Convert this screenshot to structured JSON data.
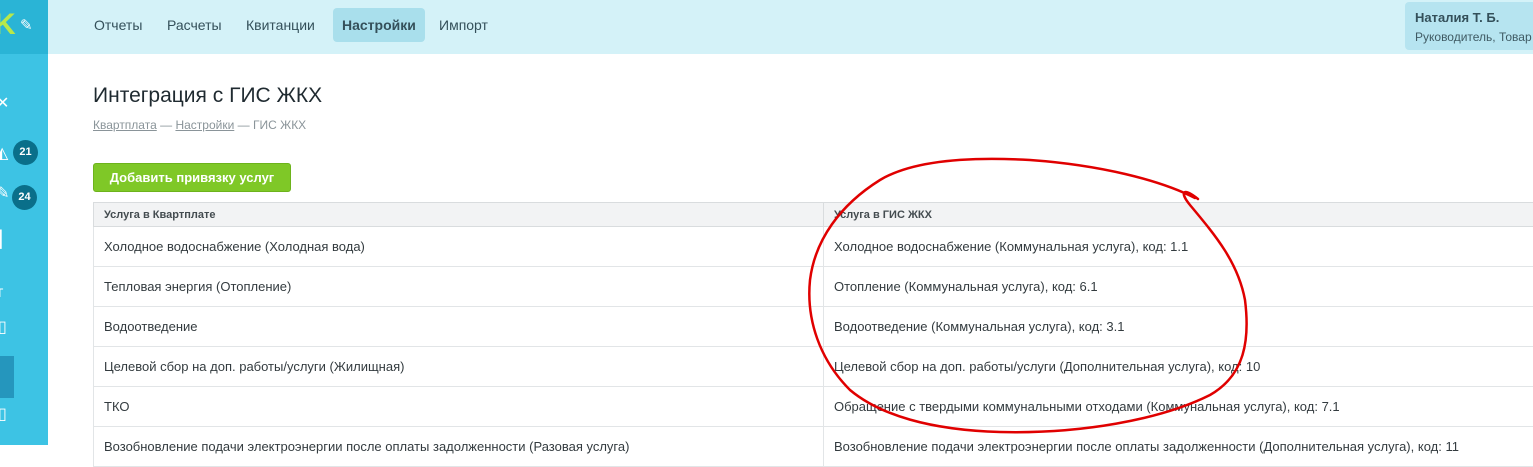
{
  "sidebar": {
    "badges": [
      "21",
      "24"
    ]
  },
  "nav": {
    "items": [
      {
        "label": "Отчеты"
      },
      {
        "label": "Расчеты"
      },
      {
        "label": "Квитанции"
      },
      {
        "label": "Настройки"
      },
      {
        "label": "Импорт"
      }
    ],
    "active": "Настройки"
  },
  "user": {
    "name": "Наталия Т. Б.",
    "role": "Руководитель, Товар"
  },
  "page": {
    "title": "Интеграция с ГИС ЖКХ",
    "breadcrumb": [
      "Квартплата",
      "Настройки",
      "ГИС ЖКХ"
    ],
    "separator": "—",
    "add_button": "Добавить привязку услуг"
  },
  "table": {
    "headers": [
      "Услуга в Квартплате",
      "Услуга в ГИС ЖКХ"
    ],
    "rows": [
      [
        "Холодное водоснабжение (Холодная вода)",
        "Холодное водоснабжение (Коммунальная услуга), код: 1.1"
      ],
      [
        "Тепловая энергия (Отопление)",
        "Отопление (Коммунальная услуга), код: 6.1"
      ],
      [
        "Водоотведение",
        "Водоотведение (Коммунальная услуга), код: 3.1"
      ],
      [
        "Целевой сбор на доп. работы/услуги (Жилищная)",
        "Целевой сбор на доп. работы/услуги (Дополнительная услуга), код: 10"
      ],
      [
        "ТКО",
        "Обращение с твердыми коммунальными отходами (Коммунальная услуга), код: 7.1"
      ],
      [
        "Возобновление подачи электроэнергии после оплаты задолженности (Разовая услуга)",
        "Возобновление подачи электроэнергии после оплаты задолженности (Дополнительная услуга), код: 11"
      ]
    ]
  },
  "colors": {
    "sidebar": "#3dc3e4",
    "topbar": "#d4f2f8",
    "button": "#7fc827",
    "annotation": "#e00000"
  }
}
